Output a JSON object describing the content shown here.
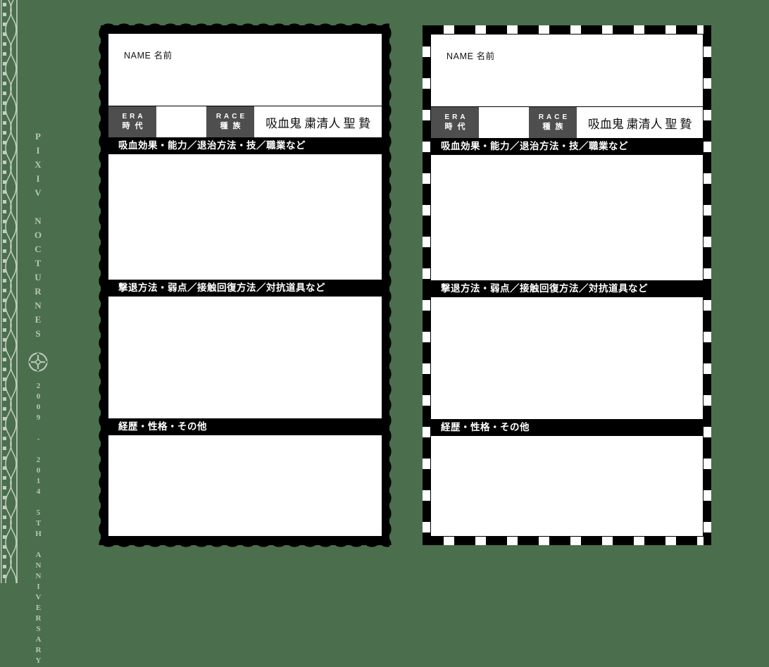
{
  "page": {
    "background_color": "#4b6e4c",
    "title": "Vampire Character Sheet Template"
  },
  "brand_strip": {
    "ornament_name": "decorative-border-ornament",
    "logo_name": "circular-crosshair-logo",
    "name_text": "PIXIV NOCTURNES",
    "anniversary_text": "2009 - 2014  5TH ANNIVERSARY",
    "text_color": "#b9c6b9"
  },
  "card": {
    "name_label": "NAME 名前",
    "era": {
      "en": "ERA",
      "jp": "時代",
      "value": ""
    },
    "race": {
      "en": "RACE",
      "jp": "種族",
      "options": [
        "吸血鬼",
        "粛清人",
        "聖",
        "贄"
      ]
    },
    "sections": [
      {
        "header": "吸血効果・能力／退治方法・技／職業など",
        "value": ""
      },
      {
        "header": "撃退方法・弱点／接触回復方法／対抗道具など",
        "value": ""
      },
      {
        "header": "経歴・性格・その他",
        "value": ""
      }
    ]
  },
  "cards": [
    {
      "id": "left",
      "edge_style": "wavy-deckled"
    },
    {
      "id": "right",
      "edge_style": "dashed-checker"
    }
  ]
}
